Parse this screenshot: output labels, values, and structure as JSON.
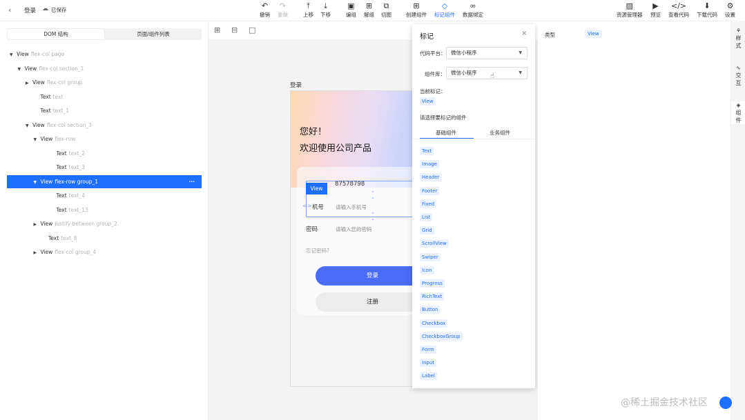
{
  "header": {
    "back_icon": "chevron-left-icon",
    "title": "登录",
    "saved": "已保存"
  },
  "toolbar": {
    "undo": "撤销",
    "redo": "重做",
    "up": "上移",
    "down": "下移",
    "group": "编组",
    "ungroup": "解组",
    "slice": "切图",
    "create": "创建组件",
    "mark": "标记组件",
    "bind": "数据绑定",
    "assets": "资源管理器",
    "preview": "预览",
    "code": "查看代码",
    "download": "下载代码",
    "settings": "设置"
  },
  "left": {
    "tabs": [
      "DOM 结构",
      "页面/组件列表"
    ],
    "tree": [
      {
        "tag": "View",
        "cls": "flex-col page",
        "indent": 0,
        "arrow": "▼"
      },
      {
        "tag": "View",
        "cls": "flex-col section_1",
        "indent": 1,
        "arrow": "▼"
      },
      {
        "tag": "View",
        "cls": "flex-col group",
        "indent": 2,
        "arrow": "▶"
      },
      {
        "tag": "Text",
        "cls": "text",
        "indent": 3,
        "arrow": ""
      },
      {
        "tag": "Text",
        "cls": "text_1",
        "indent": 3,
        "arrow": ""
      },
      {
        "tag": "View",
        "cls": "flex-col section_3",
        "indent": 2,
        "arrow": "▼"
      },
      {
        "tag": "View",
        "cls": "flex-row",
        "indent": 3,
        "arrow": "▼"
      },
      {
        "tag": "Text",
        "cls": "text_2",
        "indent": 5,
        "arrow": ""
      },
      {
        "tag": "Text",
        "cls": "text_3",
        "indent": 5,
        "arrow": ""
      },
      {
        "tag": "View",
        "cls": "flex-row group_1",
        "indent": 3,
        "arrow": "▼",
        "selected": true,
        "more": "···"
      },
      {
        "tag": "Text",
        "cls": "text_4",
        "indent": 5,
        "arrow": ""
      },
      {
        "tag": "Text",
        "cls": "text_13",
        "indent": 5,
        "arrow": ""
      },
      {
        "tag": "View",
        "cls": "justify-between group_2",
        "indent": 3,
        "arrow": "▶"
      },
      {
        "tag": "Text",
        "cls": "text_8",
        "indent": 4,
        "arrow": ""
      },
      {
        "tag": "View",
        "cls": "flex-col group_4",
        "indent": 3,
        "arrow": "▶"
      }
    ]
  },
  "canvas": {
    "page_label": "登录",
    "greeting": "您好！",
    "welcome": "欢迎使用公司产品",
    "view_badge": "View",
    "account_value": "87578798",
    "phone_label": "机号",
    "phone_placeholder": "请输入手机号",
    "pwd_label": "密码",
    "pwd_placeholder": "请输入您的密码",
    "forgot": "忘记密码?",
    "login_btn": "登录",
    "register_btn": "注册"
  },
  "panel": {
    "title": "标记",
    "platform_label": "代码平台：",
    "platform_value": "微信小程序",
    "lib_label": "组件库：",
    "lib_value": "微信小程序",
    "current_label": "当前标记：",
    "current_value": "View",
    "choose_label": "请选择要标记的组件",
    "tabs": [
      "基础组件",
      "业务组件"
    ],
    "components": [
      "Text",
      "Image",
      "Header",
      "Footer",
      "Fixed",
      "List",
      "Grid",
      "ScrollView",
      "Swiper",
      "Icon",
      "Progress",
      "RichText",
      "Button",
      "Checkbox",
      "CheckboxGroup",
      "Form",
      "Input",
      "Label"
    ]
  },
  "right": {
    "type_label": "类型",
    "type_value": "View"
  },
  "rtabs": [
    {
      "a": "样",
      "b": "式"
    },
    {
      "a": "交",
      "b": "互"
    },
    {
      "a": "组",
      "b": "件"
    }
  ],
  "watermark": "@稀土掘金技术社区",
  "colors": {
    "accent": "#1f6fff",
    "button": "#4a6cf7"
  }
}
